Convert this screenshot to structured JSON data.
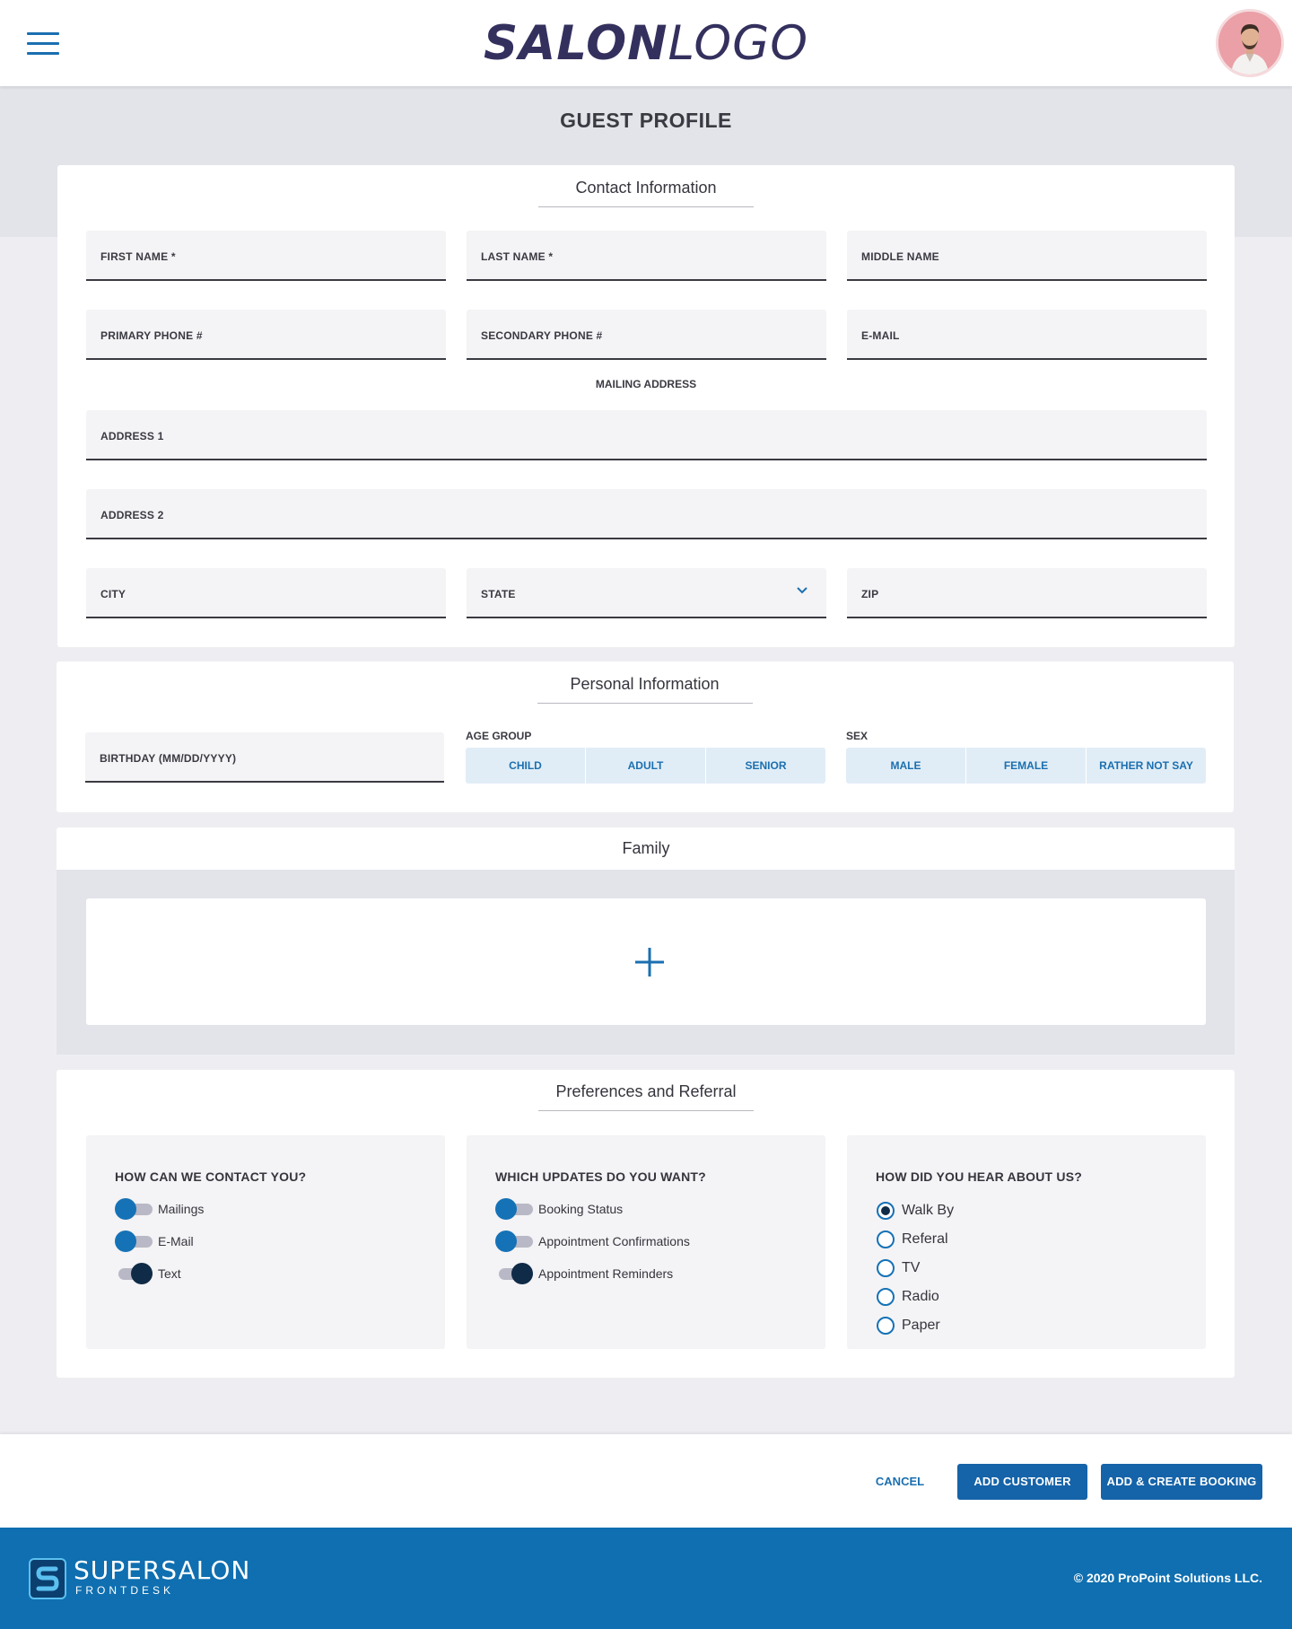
{
  "header": {
    "logo_bold": "SALON",
    "logo_light": "LOGO"
  },
  "page": {
    "title": "GUEST PROFILE"
  },
  "contact": {
    "title": "Contact Information",
    "first_name": "FIRST NAME *",
    "last_name": "LAST NAME *",
    "middle_name": "MIDDLE NAME",
    "primary_phone": "PRIMARY PHONE #",
    "secondary_phone": "SECONDARY PHONE #",
    "email": "E-MAIL",
    "mailing_address": "MAILING ADDRESS",
    "address1": "ADDRESS 1",
    "address2": "ADDRESS 2",
    "city": "CITY",
    "state": "STATE",
    "zip": "ZIP"
  },
  "personal": {
    "title": "Personal Information",
    "birthday": "BIRTHDAY (MM/DD/YYYY)",
    "age_group_label": "AGE GROUP",
    "age_groups": [
      "CHILD",
      "ADULT",
      "SENIOR"
    ],
    "sex_label": "SEX",
    "sex_options": [
      "MALE",
      "FEMALE",
      "RATHER NOT SAY"
    ]
  },
  "family": {
    "title": "Family"
  },
  "preferences": {
    "title": "Preferences and Referral",
    "contact_heading": "HOW CAN WE CONTACT YOU?",
    "contact_options": [
      {
        "label": "Mailings",
        "on": false
      },
      {
        "label": "E-Mail",
        "on": false
      },
      {
        "label": "Text",
        "on": true
      }
    ],
    "updates_heading": "WHICH UPDATES DO YOU WANT?",
    "update_options": [
      {
        "label": "Booking Status",
        "on": false
      },
      {
        "label": "Appointment Confirmations",
        "on": false
      },
      {
        "label": "Appointment Reminders",
        "on": true
      }
    ],
    "referral_heading": "HOW DID YOU HEAR ABOUT US?",
    "referral_options": [
      "Walk By",
      "Referal",
      "TV",
      "Radio",
      "Paper"
    ],
    "referral_selected": "Walk By"
  },
  "actions": {
    "cancel": "CANCEL",
    "add_customer": "ADD CUSTOMER",
    "add_and_book": "ADD & CREATE BOOKING"
  },
  "footer": {
    "brand_name": "SUPERSALON",
    "brand_sub": "FRONTDESK",
    "copyright": "© 2020 ProPoint Solutions LLC."
  },
  "colors": {
    "accent": "#1b6fb0",
    "footer": "#0f6fb0",
    "logo": "#34305e"
  }
}
